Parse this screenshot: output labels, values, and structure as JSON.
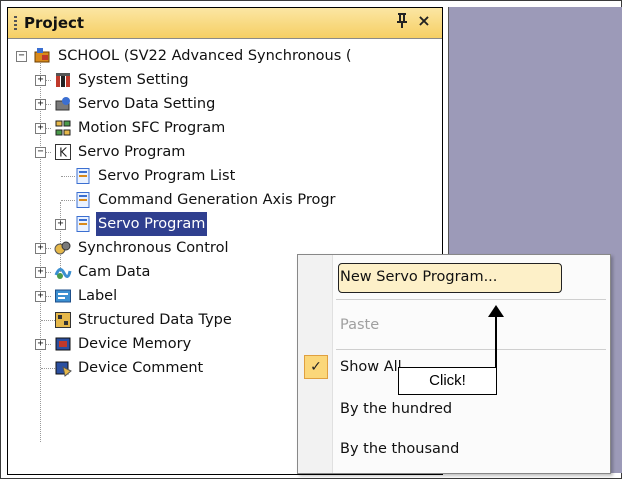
{
  "panel": {
    "title": "Project",
    "pin_glyph": "ᵖ",
    "close_glyph": "×"
  },
  "tree": {
    "root": "SCHOOL (SV22 Advanced Synchronous (",
    "items": [
      {
        "label": "System Setting",
        "icon": "system-setting-icon",
        "expander": "+"
      },
      {
        "label": "Servo Data Setting",
        "icon": "servo-data-icon",
        "expander": "+"
      },
      {
        "label": "Motion SFC Program",
        "icon": "sfc-program-icon",
        "expander": "+"
      },
      {
        "label": "Servo Program",
        "icon": "servo-program-folder-icon",
        "expander": "−"
      },
      {
        "label": "Servo Program List",
        "icon": "program-list-icon",
        "expander": ""
      },
      {
        "label": "Command Generation Axis Progr",
        "icon": "program-list-icon",
        "expander": ""
      },
      {
        "label": "Servo Program",
        "icon": "program-list-icon",
        "expander": "+"
      },
      {
        "label": "Synchronous Control",
        "icon": "sync-control-icon",
        "expander": "+"
      },
      {
        "label": "Cam Data",
        "icon": "cam-data-icon",
        "expander": "+"
      },
      {
        "label": "Label",
        "icon": "label-icon",
        "expander": "+"
      },
      {
        "label": "Structured Data Type",
        "icon": "structured-data-icon",
        "expander": ""
      },
      {
        "label": "Device Memory",
        "icon": "device-memory-icon",
        "expander": "+"
      },
      {
        "label": "Device Comment",
        "icon": "device-comment-icon",
        "expander": ""
      }
    ]
  },
  "context_menu": {
    "new_servo_program": "New Servo Program...",
    "paste": "Paste",
    "show_all": "Show All",
    "by_hundred": "By the hundred",
    "by_thousand": "By the thousand",
    "check_glyph": "✓"
  },
  "callout": {
    "text": "Click!"
  },
  "colors": {
    "header_gradient_top": "#fbe6a3",
    "header_gradient_bottom": "#f6cf64",
    "selection": "#2f3f8f",
    "side_area": "#9c9ab8",
    "menu_highlight": "#fdf0c8"
  }
}
